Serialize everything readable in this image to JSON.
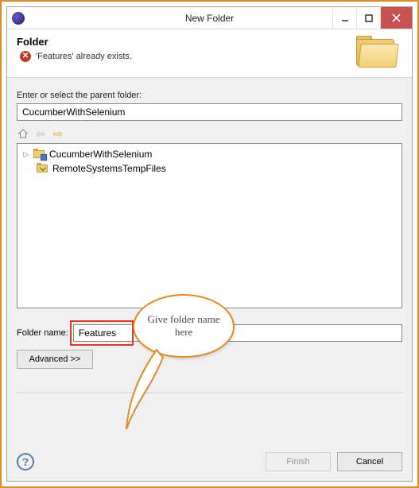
{
  "window": {
    "title": "New Folder"
  },
  "header": {
    "title": "Folder",
    "error_message": "'Features' already exists."
  },
  "parent": {
    "label": "Enter or select the parent folder:",
    "value": "CucumberWithSelenium"
  },
  "tree": {
    "items": [
      {
        "label": "CucumberWithSelenium"
      },
      {
        "label": "RemoteSystemsTempFiles"
      }
    ]
  },
  "folder_name": {
    "label": "Folder name:",
    "value": "Features"
  },
  "buttons": {
    "advanced": "Advanced >>",
    "finish": "Finish",
    "cancel": "Cancel"
  },
  "callout": {
    "text": "Give folder name here"
  }
}
